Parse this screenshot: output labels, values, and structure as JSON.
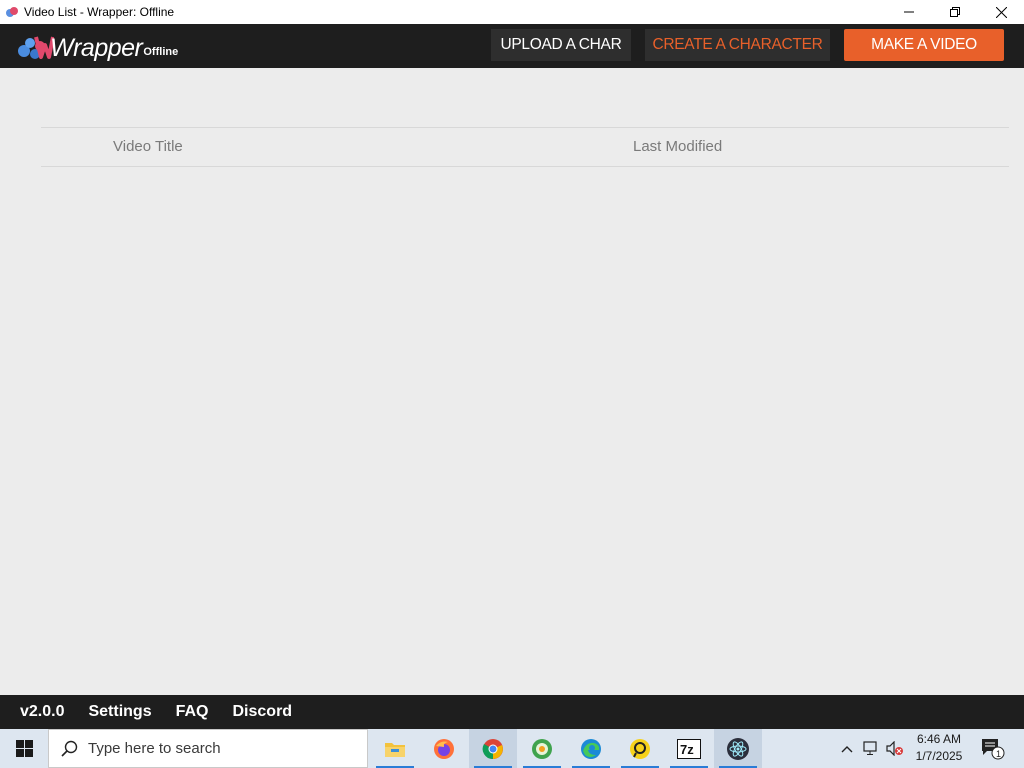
{
  "window": {
    "title": "Video List - Wrapper: Offline"
  },
  "logo": {
    "wordmark": "Wrapper",
    "suffix": "Offline"
  },
  "header": {
    "upload_label": "UPLOAD A CHAR",
    "create_label": "CREATE A CHARACTER",
    "make_label": "MAKE A VIDEO"
  },
  "table": {
    "columns": [
      "Video Title",
      "Last Modified"
    ]
  },
  "footer": {
    "version": "v2.0.0",
    "settings": "Settings",
    "faq": "FAQ",
    "discord": "Discord"
  },
  "taskbar": {
    "search_placeholder": "Type here to search",
    "time": "6:46 AM",
    "date": "1/7/2025",
    "notification_count": "1",
    "apps": [
      "file-explorer-icon",
      "firefox-icon",
      "chrome-icon",
      "app-icon",
      "edge-icon",
      "app-icon",
      "7zip-icon",
      "electron-icon"
    ]
  },
  "colors": {
    "accent": "#e8602a",
    "header_bg": "#1e1e1e",
    "content_bg": "#ececec"
  }
}
